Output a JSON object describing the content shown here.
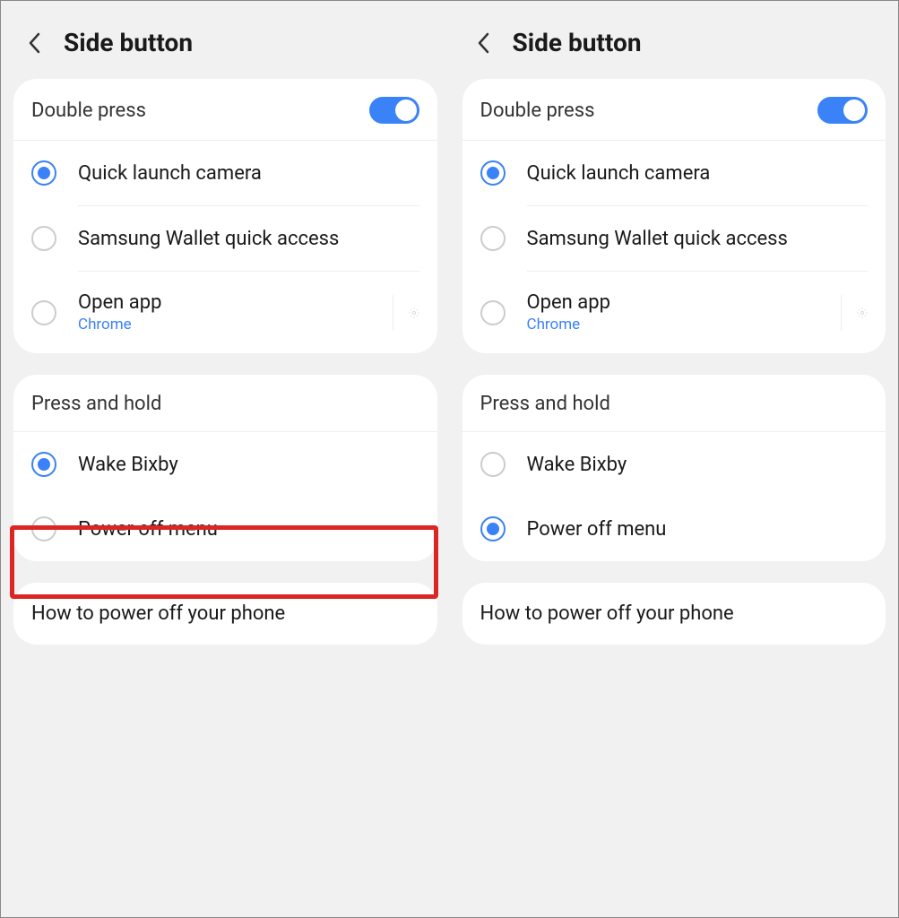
{
  "panels": [
    {
      "header_title": "Side button",
      "double_press": {
        "title": "Double press",
        "toggle_on": true,
        "options": [
          {
            "label": "Quick launch camera",
            "selected": true
          },
          {
            "label": "Samsung Wallet quick access",
            "selected": false
          },
          {
            "label": "Open app",
            "sublabel": "Chrome",
            "selected": false,
            "has_gear": true
          }
        ]
      },
      "press_hold": {
        "title": "Press and hold",
        "options": [
          {
            "label": "Wake Bixby",
            "selected": true
          },
          {
            "label": "Power off menu",
            "selected": false
          }
        ]
      },
      "footer_link": "How to power off your phone",
      "highlight_power_off": true
    },
    {
      "header_title": "Side button",
      "double_press": {
        "title": "Double press",
        "toggle_on": true,
        "options": [
          {
            "label": "Quick launch camera",
            "selected": true
          },
          {
            "label": "Samsung Wallet quick access",
            "selected": false
          },
          {
            "label": "Open app",
            "sublabel": "Chrome",
            "selected": false,
            "has_gear": true
          }
        ]
      },
      "press_hold": {
        "title": "Press and hold",
        "options": [
          {
            "label": "Wake Bixby",
            "selected": false
          },
          {
            "label": "Power off menu",
            "selected": true
          }
        ]
      },
      "footer_link": "How to power off your phone",
      "highlight_power_off": false
    }
  ],
  "colors": {
    "accent": "#3a82f7",
    "highlight": "#dc2626"
  }
}
